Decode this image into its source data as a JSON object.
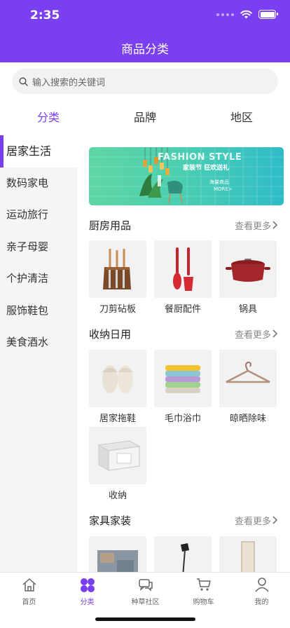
{
  "status": {
    "time": "2:35"
  },
  "header": {
    "title": "商品分类"
  },
  "search": {
    "placeholder": "输入搜索的关键词"
  },
  "tabs": [
    {
      "label": "分类"
    },
    {
      "label": "品牌"
    },
    {
      "label": "地区"
    }
  ],
  "sidebar": {
    "items": [
      {
        "label": "居家生活"
      },
      {
        "label": "数码家电"
      },
      {
        "label": "运动旅行"
      },
      {
        "label": "亲子母婴"
      },
      {
        "label": "个护清洁"
      },
      {
        "label": "服饰鞋包"
      },
      {
        "label": "美食酒水"
      }
    ]
  },
  "banner": {
    "title": "FASHION STYLE",
    "subtitle": "家装节 狂欢送礼",
    "tag": "海量商品",
    "more": "MORE>"
  },
  "sections": [
    {
      "title": "厨房用品",
      "more": "查看更多",
      "items": [
        {
          "label": "刀剪砧板"
        },
        {
          "label": "餐厨配件"
        },
        {
          "label": "锅具"
        }
      ]
    },
    {
      "title": "收纳日用",
      "more": "查看更多",
      "items": [
        {
          "label": "居家拖鞋"
        },
        {
          "label": "毛巾浴巾"
        },
        {
          "label": "晾晒除味"
        },
        {
          "label": "收纳"
        }
      ]
    },
    {
      "title": "家具家装",
      "more": "查看更多",
      "items": []
    }
  ],
  "tabbar": [
    {
      "label": "首页"
    },
    {
      "label": "分类"
    },
    {
      "label": "种草社区"
    },
    {
      "label": "购物车"
    },
    {
      "label": "我的"
    }
  ],
  "colors": {
    "accent": "#7a3ff0"
  }
}
